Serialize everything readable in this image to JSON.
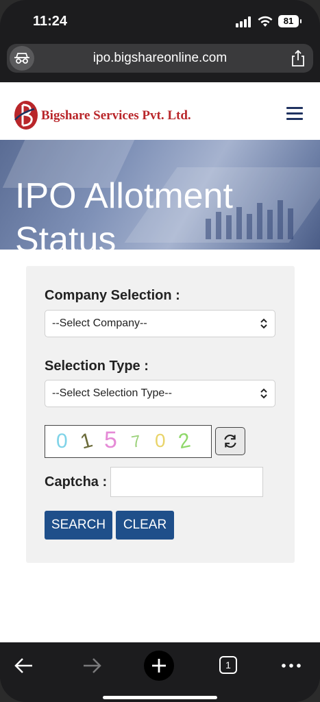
{
  "status_bar": {
    "time": "11:24",
    "battery": "81"
  },
  "browser": {
    "url": "ipo.bigshareonline.com"
  },
  "site": {
    "logo_text": "Bigshare Services Pvt. Ltd."
  },
  "hero": {
    "title_line1": "IPO Allotment",
    "title_line2": "Status"
  },
  "form": {
    "company_label": "Company Selection :",
    "company_value": "--Select Company--",
    "type_label": "Selection Type :",
    "type_value": "--Select Selection Type--",
    "captcha_digits": [
      "0",
      "1",
      "5",
      "7",
      "0",
      "2"
    ],
    "captcha_label": "Captcha :",
    "captcha_input_value": "",
    "search_label": "SEARCH",
    "clear_label": "CLEAR"
  },
  "toolbar": {
    "tab_count": "1"
  },
  "colors": {
    "brand_red": "#b9262a",
    "brand_blue": "#1f4f8a",
    "navy": "#1f3260"
  },
  "icons": [
    "incognito-icon",
    "share-icon",
    "hamburger-icon",
    "refresh-icon",
    "back-icon",
    "forward-icon",
    "new-tab-icon",
    "tabs-icon",
    "more-icon"
  ]
}
